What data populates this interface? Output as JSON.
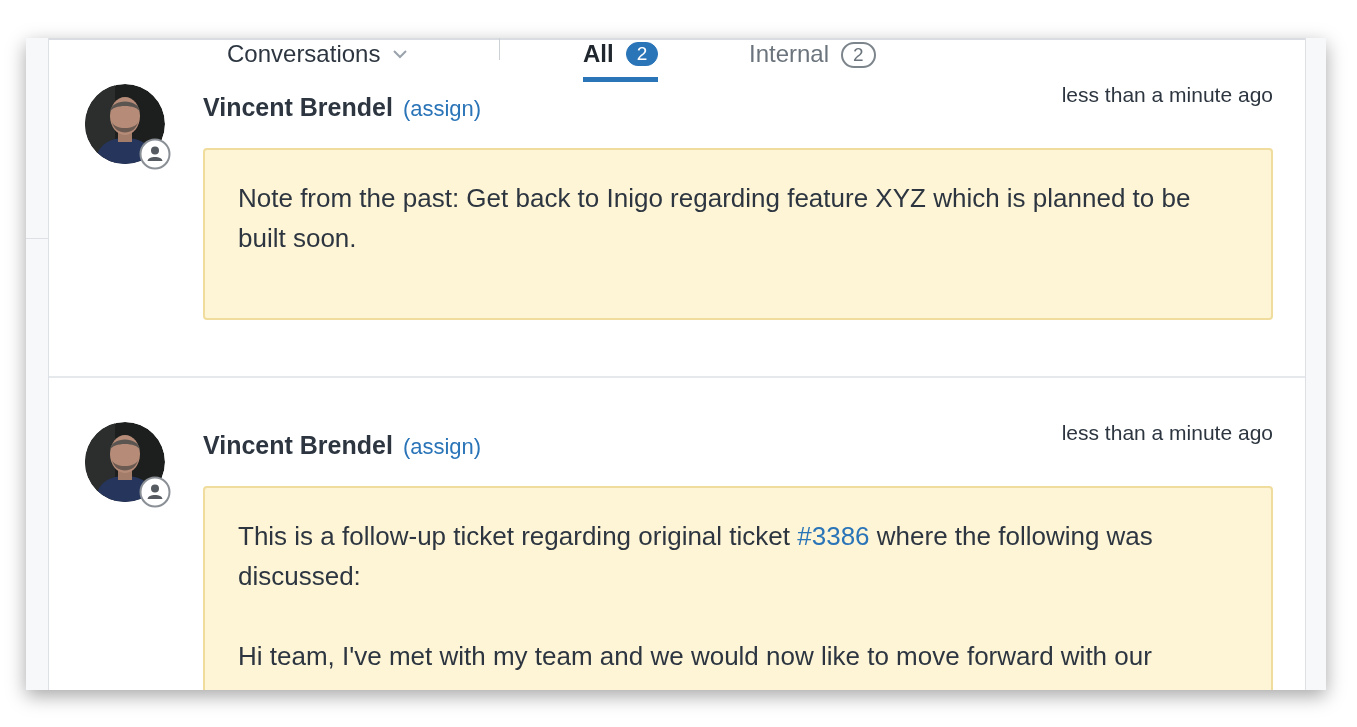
{
  "header": {
    "view_menu": "Conversations",
    "tabs": [
      {
        "label": "All",
        "count": "2",
        "selected": true
      },
      {
        "label": "Internal",
        "count": "2",
        "selected": false
      }
    ]
  },
  "messages": [
    {
      "author": "Vincent Brendel",
      "action": "(assign)",
      "time": "less than a minute ago",
      "paragraphs": [
        [
          {
            "kind": "text",
            "text": "Note from the past: Get back to Inigo regarding feature XYZ which is planned to be built soon."
          }
        ]
      ]
    },
    {
      "author": "Vincent Brendel",
      "action": "(assign)",
      "time": "less than a minute ago",
      "paragraphs": [
        [
          {
            "kind": "text",
            "text": "This is a follow-up ticket regarding original ticket "
          },
          {
            "kind": "link",
            "text": "#3386"
          },
          {
            "kind": "text",
            "text": " where the following was discussed:"
          }
        ],
        [
          {
            "kind": "text",
            "text": "Hi team, I've met with my team and we would now like to move forward with our"
          }
        ]
      ]
    }
  ]
}
